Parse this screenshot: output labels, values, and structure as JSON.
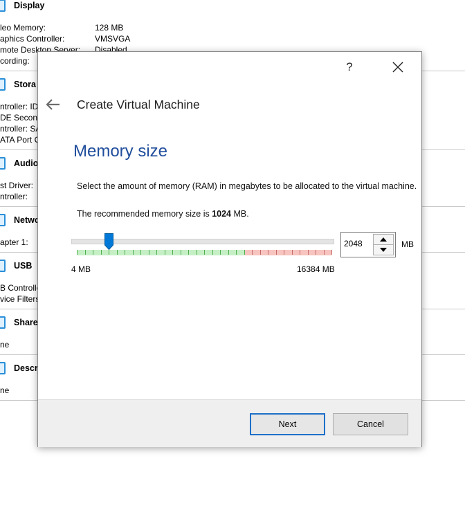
{
  "background": {
    "sections": [
      {
        "title": "Display",
        "rows": [
          {
            "label": "leo Memory:",
            "value": "128 MB"
          },
          {
            "label": "aphics Controller:",
            "value": "VMSVGA"
          },
          {
            "label": "mote Desktop Server:",
            "value": "Disabled"
          },
          {
            "label": "cording:",
            "value": ""
          }
        ]
      },
      {
        "title": "Stora",
        "rows": [
          {
            "label": "ntroller: ID",
            "value": ""
          },
          {
            "label": "DE Second",
            "value": ""
          },
          {
            "label": "ntroller: SA",
            "value": ""
          },
          {
            "label": "ATA Port C",
            "value": ""
          }
        ]
      },
      {
        "title": "Audio",
        "rows": [
          {
            "label": "st Driver:",
            "value": ""
          },
          {
            "label": "ntroller:",
            "value": ""
          }
        ]
      },
      {
        "title": "Netwo",
        "rows": [
          {
            "label": "apter 1:",
            "value": ""
          }
        ]
      },
      {
        "title": "USB",
        "rows": [
          {
            "label": "B Controlle",
            "value": ""
          },
          {
            "label": "vice Filters",
            "value": ""
          }
        ]
      },
      {
        "title": "Share",
        "rows": [
          {
            "label": "ne",
            "value": ""
          }
        ]
      },
      {
        "title": "Descr",
        "rows": [
          {
            "label": "ne",
            "value": ""
          }
        ]
      }
    ]
  },
  "dialog": {
    "help_label": "?",
    "title": "Create Virtual Machine",
    "heading": "Memory size",
    "description": "Select the amount of memory (RAM) in megabytes to be allocated to the virtual machine.",
    "recommended_prefix": "The recommended memory size is ",
    "recommended_value": "1024",
    "recommended_suffix": " MB.",
    "slider": {
      "min": 4,
      "max": 16384,
      "value": 2048,
      "safe_fraction": 0.66,
      "min_label": "4 MB",
      "max_label": "16384 MB"
    },
    "spinbox_value": "2048",
    "unit_label": "MB",
    "next_label": "Next",
    "cancel_label": "Cancel"
  },
  "colors": {
    "heading": "#1f4d9c",
    "accent": "#0078d7",
    "safe_band": "#c6efc6",
    "warn_band": "#f7c4c0"
  }
}
